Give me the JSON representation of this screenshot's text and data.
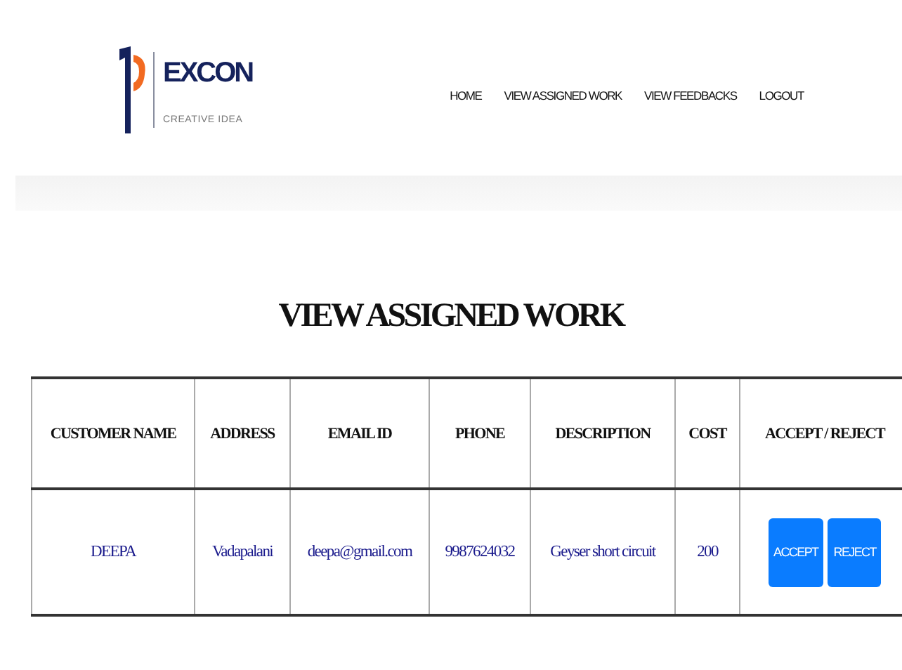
{
  "brand": {
    "name": "EXCON",
    "tagline": "CREATIVE IDEA"
  },
  "nav": [
    {
      "label": "HOME"
    },
    {
      "label": "VIEW ASSIGNED WORK"
    },
    {
      "label": "VIEW FEEDBACKS"
    },
    {
      "label": "LOGOUT"
    }
  ],
  "heading": "VIEW ASSIGNED WORK",
  "table": {
    "columns": [
      "CUSTOMER NAME",
      "ADDRESS",
      "EMAIL ID",
      "PHONE",
      "DESCRIPTION",
      "COST",
      "ACCEPT / REJECT"
    ],
    "rows": [
      {
        "cells": [
          "DEEPA",
          "Vadapalani",
          "deepa@gmail.com",
          "9987624032",
          "Geyser short circuit",
          "200"
        ],
        "actions": [
          "ACCEPT",
          "REJECT"
        ]
      }
    ]
  }
}
